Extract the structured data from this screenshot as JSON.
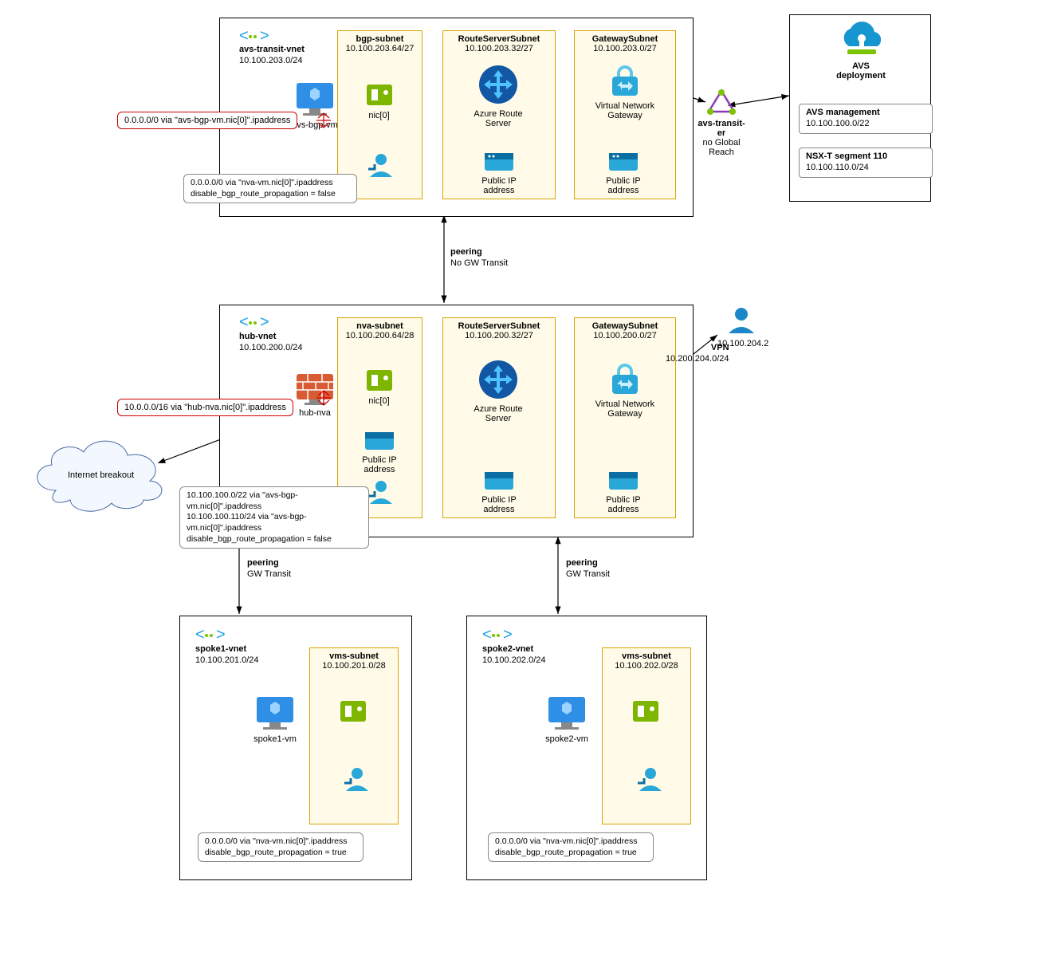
{
  "vnets": {
    "transit": {
      "name": "avs-transit-vnet",
      "cidr": "10.100.203.0/24"
    },
    "hub": {
      "name": "hub-vnet",
      "cidr": "10.100.200.0/24"
    },
    "spoke1": {
      "name": "spoke1-vnet",
      "cidr": "10.100.201.0/24"
    },
    "spoke2": {
      "name": "spoke2-vnet",
      "cidr": "10.100.202.0/24"
    }
  },
  "subnets": {
    "transit_bgp": {
      "name": "bgp-subnet",
      "cidr": "10.100.203.64/27"
    },
    "transit_rs": {
      "name": "RouteServerSubnet",
      "cidr": "10.100.203.32/27"
    },
    "transit_gw": {
      "name": "GatewaySubnet",
      "cidr": "10.100.203.0/27"
    },
    "hub_nva": {
      "name": "nva-subnet",
      "cidr": "10.100.200.64/28"
    },
    "hub_rs": {
      "name": "RouteServerSubnet",
      "cidr": "10.100.200.32/27"
    },
    "hub_gw": {
      "name": "GatewaySubnet",
      "cidr": "10.100.200.0/27"
    },
    "spoke1_vms": {
      "name": "vms-subnet",
      "cidr": "10.100.201.0/28"
    },
    "spoke2_vms": {
      "name": "vms-subnet",
      "cidr": "10.100.202.0/28"
    }
  },
  "resources": {
    "avs_bgp_vm": "avs-bgp-vm",
    "hub_nva": "hub-nva",
    "spoke1_vm": "spoke1-vm",
    "spoke2_vm": "spoke2-vm",
    "nic": "nic[0]",
    "ars": "Azure Route Server",
    "vng": "Virtual Network Gateway",
    "pip": "Public IP address"
  },
  "external": {
    "er": {
      "name": "avs-transit-er",
      "note": "no Global Reach"
    },
    "avs": {
      "title": "AVS deployment",
      "mgmt_name": "AVS management",
      "mgmt_cidr": "10.100.100.0/22",
      "seg_name": "NSX-T segment 110",
      "seg_cidr": "10.100.110.0/24"
    },
    "vpn": {
      "label": "VPN",
      "subnet": "10.200.204.0/24",
      "peer": "10.100.204.2"
    },
    "internet": "Internet breakout"
  },
  "peerings": {
    "t_h": {
      "title": "peering",
      "note": "No GW Transit"
    },
    "h_s": {
      "title": "peering",
      "note": "GW Transit"
    }
  },
  "routes": {
    "transit1": "0.0.0.0/0 via \"avs-bgp-vm.nic[0]\".ipaddress",
    "transit2_line1": "0.0.0.0/0 via \"nva-vm.nic[0]\".ipaddress",
    "transit2_line2": "disable_bgp_route_propagation = false",
    "hub1": "10.0.0.0/16 via \"hub-nva.nic[0]\".ipaddress",
    "hub2_line1": "10.100.100.0/22 via \"avs-bgp-vm.nic[0]\".ipaddress",
    "hub2_line2": "10.100.100.110/24 via \"avs-bgp-vm.nic[0]\".ipaddress",
    "hub2_line3": "disable_bgp_route_propagation = false",
    "spoke_line1": "0.0.0.0/0 via \"nva-vm.nic[0]\".ipaddress",
    "spoke_line2": "disable_bgp_route_propagation = true"
  }
}
